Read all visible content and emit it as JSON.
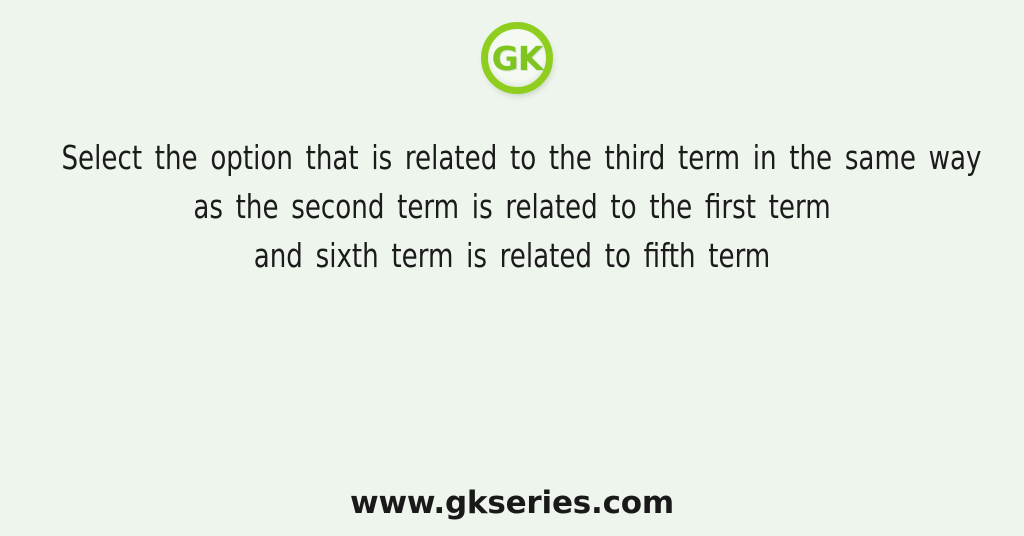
{
  "background_color": "#edf5ec",
  "logo": {
    "name": "gk-logo",
    "text": "GK",
    "ring_color": "#8fce1e",
    "letter_color": "#7ec520",
    "inner_color": "#f4faf2"
  },
  "question": {
    "text_color": "#1b1b1b",
    "lines": [
      "Select the option that is related to the third term in the same way",
      "as the second term is related to the first term",
      "and sixth term is related to fifth term"
    ]
  },
  "footer": {
    "url": "www.gkseries.com",
    "text_color": "#191919"
  }
}
